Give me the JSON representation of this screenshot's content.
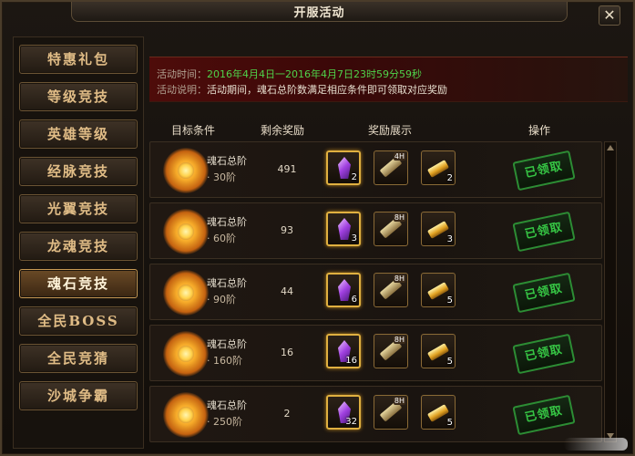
{
  "window": {
    "title": "开服活动",
    "close_glyph": "✕"
  },
  "sidebar": {
    "items": [
      {
        "label": "特惠礼包",
        "active": false
      },
      {
        "label": "等级竞技",
        "active": false
      },
      {
        "label": "英雄等级",
        "active": false
      },
      {
        "label": "经脉竞技",
        "active": false
      },
      {
        "label": "光翼竞技",
        "active": false
      },
      {
        "label": "龙魂竞技",
        "active": false
      },
      {
        "label": "魂石竞技",
        "active": true
      },
      {
        "label": "全民BOSS",
        "active": false
      },
      {
        "label": "全民竞猜",
        "active": false
      },
      {
        "label": "沙城争霸",
        "active": false
      }
    ]
  },
  "banner": {
    "time_label": "活动时间：",
    "time_value": "2016年4月4日一2016年4月7日23时59分59秒",
    "desc_label": "活动说明：",
    "desc_value": "活动期间，魂石总阶数满足相应条件即可领取对应奖励"
  },
  "table": {
    "headers": {
      "target": "目标条件",
      "remain": "剩余奖励",
      "rewards": "奖励展示",
      "action": "操作"
    },
    "rows": [
      {
        "cond": "魂石总阶",
        "req": "· 30阶",
        "remain": "491",
        "r1": "2",
        "r2_hours": "4H",
        "r3": "2",
        "claim": "已领取"
      },
      {
        "cond": "魂石总阶",
        "req": "· 60阶",
        "remain": "93",
        "r1": "3",
        "r2_hours": "8H",
        "r3": "3",
        "claim": "已领取"
      },
      {
        "cond": "魂石总阶",
        "req": "· 90阶",
        "remain": "44",
        "r1": "6",
        "r2_hours": "8H",
        "r3": "5",
        "claim": "已领取"
      },
      {
        "cond": "魂石总阶",
        "req": "· 160阶",
        "remain": "16",
        "r1": "16",
        "r2_hours": "8H",
        "r3": "5",
        "claim": "已领取"
      },
      {
        "cond": "魂石总阶",
        "req": "· 250阶",
        "remain": "2",
        "r1": "32",
        "r2_hours": "8H",
        "r3": "5",
        "claim": "已领取"
      }
    ]
  },
  "colors": {
    "accent_green": "#39d84a",
    "banner_red": "#4e0c0a",
    "gold": "#e0b040"
  }
}
